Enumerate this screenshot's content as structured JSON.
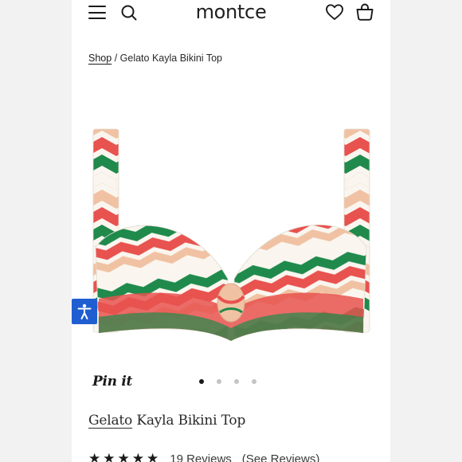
{
  "header": {
    "logo": "montce",
    "menu_icon": "hamburger-menu-icon",
    "search_icon": "search-icon",
    "wishlist_icon": "heart-icon",
    "cart_icon": "shopping-bag-icon"
  },
  "breadcrumb": {
    "shop_label": "Shop",
    "separator": "/",
    "current": "Gelato Kayla Bikini Top"
  },
  "product": {
    "image_icon": "bikini-top-image",
    "pin_label": "Pin it",
    "gallery": {
      "count": 4,
      "active_index": 0
    },
    "title_word1": "Gelato",
    "title_rest": "Kayla Bikini Top",
    "rating": {
      "stars": 5,
      "reviews_text": "19 Reviews",
      "see_reviews": "(See Reviews)"
    }
  },
  "colors": {
    "green": "#1f8a4c",
    "coral": "#e8524f",
    "peach": "#f0c2a3",
    "cream": "#faf6ef",
    "accessibility_blue": "#1f5ed1"
  },
  "accessibility": {
    "icon": "accessibility-icon"
  }
}
